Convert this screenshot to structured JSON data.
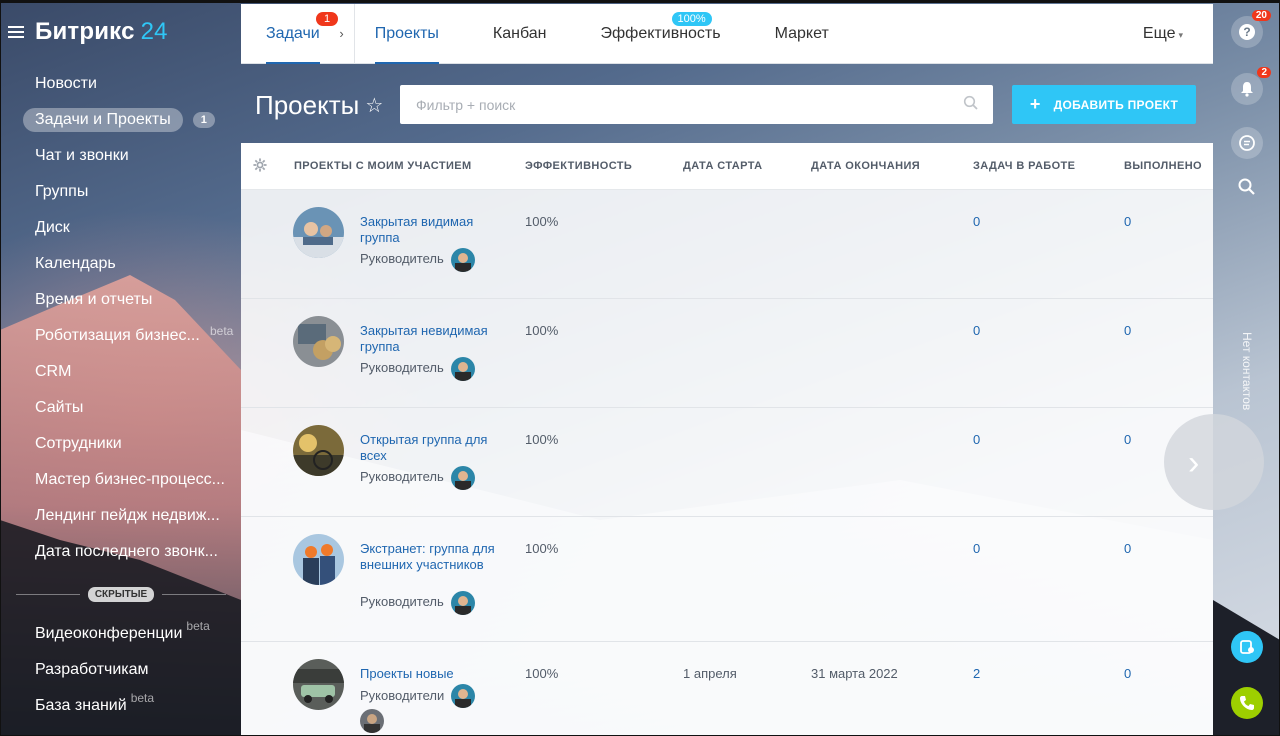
{
  "app": {
    "logo_main": "Битрикс",
    "logo_num": "24"
  },
  "sidebar": {
    "items": [
      {
        "label": "Новости"
      },
      {
        "label": "Задачи и Проекты",
        "count": "1"
      },
      {
        "label": "Чат и звонки"
      },
      {
        "label": "Группы"
      },
      {
        "label": "Диск"
      },
      {
        "label": "Календарь"
      },
      {
        "label": "Время и отчеты"
      },
      {
        "label": "Роботизация бизнес...",
        "beta": "beta"
      },
      {
        "label": "CRM"
      },
      {
        "label": "Сайты"
      },
      {
        "label": "Сотрудники"
      },
      {
        "label": "Мастер бизнес-процесс..."
      },
      {
        "label": "Лендинг пейдж недвиж..."
      },
      {
        "label": "Дата последнего звонк..."
      }
    ],
    "hidden_label": "СКРЫТЫЕ",
    "hidden_items": [
      {
        "label": "Видеоконференции",
        "beta": "beta"
      },
      {
        "label": "Разработчикам"
      },
      {
        "label": "База знаний",
        "beta": "beta"
      }
    ]
  },
  "topnav": {
    "tabs": [
      {
        "label": "Задачи",
        "badge": "1"
      },
      {
        "label": "Проекты"
      },
      {
        "label": "Канбан"
      },
      {
        "label": "Эффективность",
        "badge": "100%"
      },
      {
        "label": "Маркет"
      }
    ],
    "more": "Еще"
  },
  "page": {
    "title": "Проекты",
    "search_placeholder": "Фильтр + поиск",
    "add_button": "ДОБАВИТЬ ПРОЕКТ"
  },
  "table": {
    "headers": [
      "ПРОЕКТЫ С МОИМ УЧАСТИЕМ",
      "ЭФФЕКТИВНОСТЬ",
      "ДАТА СТАРТА",
      "ДАТА ОКОНЧАНИЯ",
      "ЗАДАЧ В РАБОТЕ",
      "ВЫПОЛНЕНО"
    ],
    "rows": [
      {
        "name": "Закрытая видимая группа",
        "role": "Руководитель",
        "efficiency": "100%",
        "start": "",
        "end": "",
        "in_work": "0",
        "done": "0"
      },
      {
        "name": "Закрытая невидимая группа",
        "role": "Руководитель",
        "efficiency": "100%",
        "start": "",
        "end": "",
        "in_work": "0",
        "done": "0"
      },
      {
        "name": "Открытая группа для всех",
        "role": "Руководитель",
        "efficiency": "100%",
        "start": "",
        "end": "",
        "in_work": "0",
        "done": "0"
      },
      {
        "name": "Экстранет: группа для внешних участников",
        "role": "Руководитель",
        "efficiency": "100%",
        "start": "",
        "end": "",
        "in_work": "0",
        "done": "0"
      },
      {
        "name": "Проекты новые",
        "role": "Руководители",
        "efficiency": "100%",
        "start": "1 апреля",
        "end": "31 марта 2022",
        "in_work": "2",
        "done": "0"
      }
    ]
  },
  "rightbar": {
    "help_badge": "20",
    "notify_badge": "2",
    "no_contacts": "Нет контактов"
  },
  "colors": {
    "accent": "#2fc6f6",
    "link": "#2067b0",
    "badge": "#f0371b",
    "call": "#9dcf00"
  }
}
